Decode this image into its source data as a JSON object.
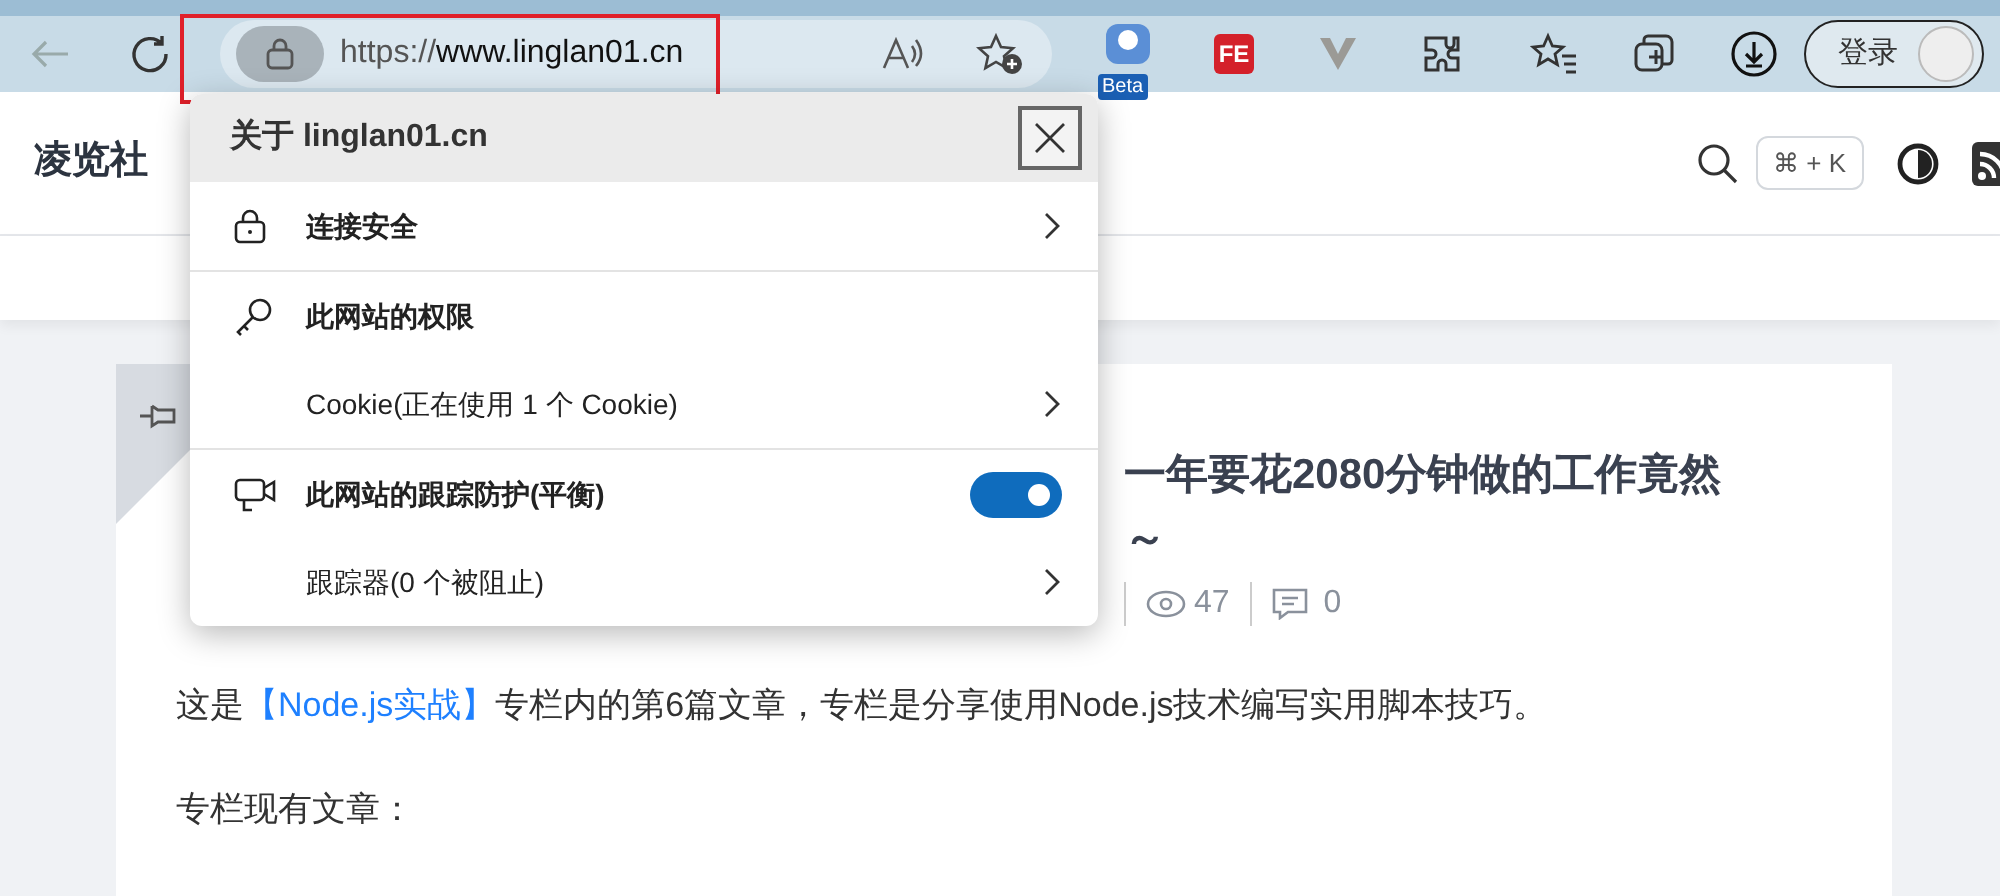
{
  "browser": {
    "url_scheme": "https://",
    "url_host": "www.linglan01.cn",
    "beta_badge": "Beta",
    "fe_label": "FE",
    "login": "登录"
  },
  "site": {
    "logo": "凌览社",
    "shortcut": "⌘ + K"
  },
  "article": {
    "title_line1": "一年要花2080分钟做的工作竟然",
    "title_line2": "～",
    "views": "47",
    "comments": "0",
    "intro": {
      "before": "这是",
      "link": "【Node.js实战】",
      "after": "专栏内的第6篇文章，专栏是分享使用Node.js技术编写实用脚本技巧。"
    },
    "list_heading": "专栏现有文章："
  },
  "popup": {
    "title": "关于 linglan01.cn",
    "sections": [
      {
        "rows": [
          {
            "kind": "link",
            "label": "连接安全",
            "bold": true
          }
        ]
      },
      {
        "rows": [
          {
            "kind": "heading",
            "label": "此网站的权限",
            "bold": true
          },
          {
            "kind": "link",
            "label": "Cookie(正在使用 1 个 Cookie)",
            "bold": false
          }
        ]
      },
      {
        "rows": [
          {
            "kind": "toggle",
            "label": "此网站的跟踪防护(平衡)",
            "bold": true,
            "on": true
          },
          {
            "kind": "link",
            "label": "跟踪器(0 个被阻止)",
            "bold": false
          }
        ]
      }
    ]
  }
}
